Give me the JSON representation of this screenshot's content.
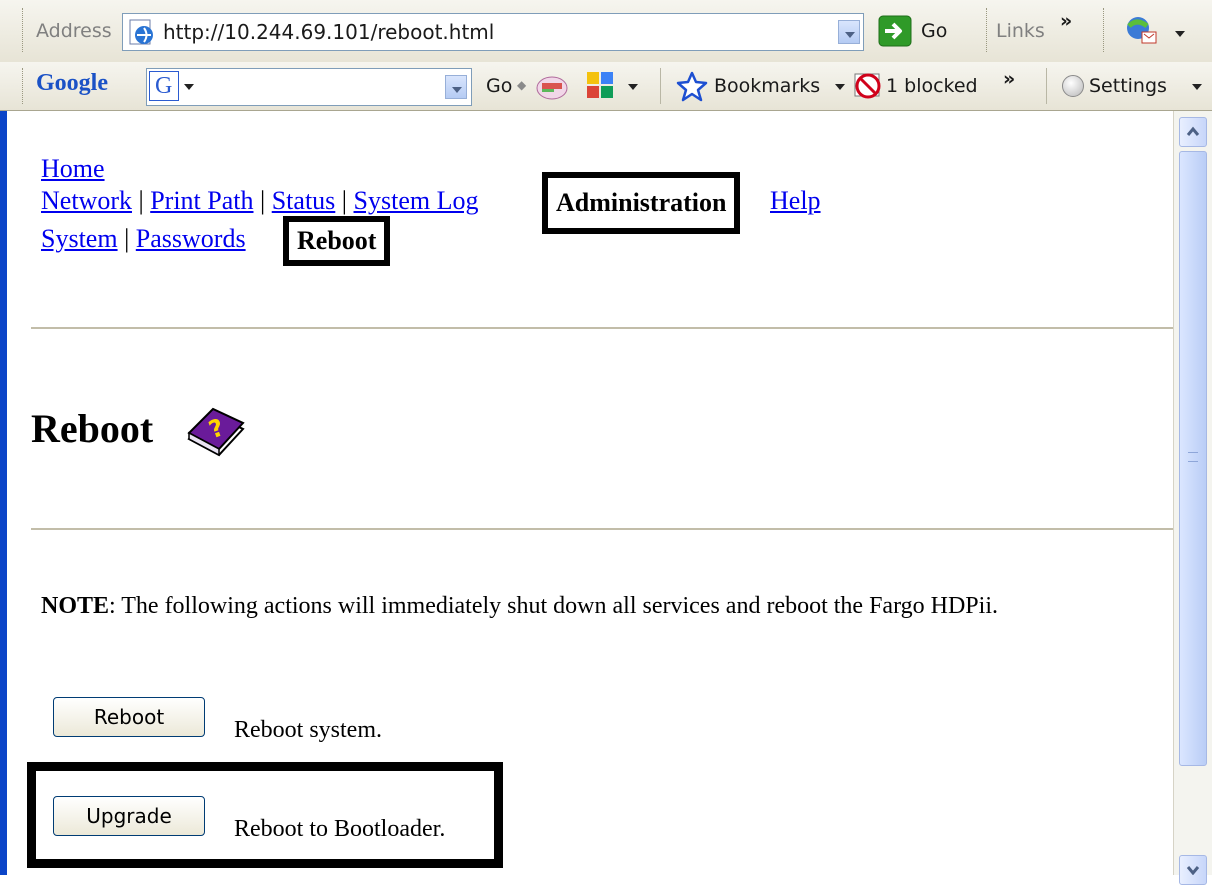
{
  "browser": {
    "address_label": "Address",
    "url": "http://10.244.69.101/reboot.html",
    "go_label": "Go",
    "links_label": "Links",
    "more_glyph": "»",
    "google_logo": "Google",
    "google_go": "Go",
    "bookmarks_label": "Bookmarks",
    "popups_label": "1 blocked",
    "settings_label": "Settings"
  },
  "nav": {
    "home": "Home",
    "network": "Network",
    "print_path": "Print Path",
    "status": "Status",
    "system_log": "System Log",
    "administration": "Administration",
    "help": "Help",
    "system": "System",
    "passwords": "Passwords",
    "reboot": "Reboot",
    "separator": "|"
  },
  "page": {
    "heading": "Reboot",
    "note_label": "NOTE",
    "note_text": ": The following actions will immediately shut down all services and reboot the Fargo HDPii.",
    "actions": [
      {
        "button": "Reboot",
        "description": "Reboot system."
      },
      {
        "button": "Upgrade",
        "description": "Reboot to Bootloader."
      }
    ]
  },
  "colors": {
    "link": "#0000ee",
    "highlight_box": "#000000",
    "help_book": "#6a1b9a"
  }
}
